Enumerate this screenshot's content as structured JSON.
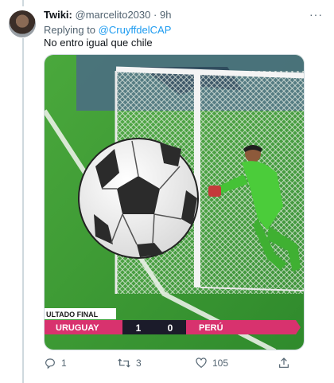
{
  "tweet": {
    "name": "Twiki",
    "separator": ":",
    "handle": "@marcelito2030",
    "dot": "·",
    "time": "9h",
    "more_label": "···",
    "reply_prefix": "Replying to",
    "reply_to": "@CruyffdelCAP",
    "text": "No entro igual que chile"
  },
  "media": {
    "scoreboard": {
      "label": "ULTADO FINAL",
      "home_team": "URUGUAY",
      "home_score": "1",
      "away_score": "0",
      "away_team": "PERÚ"
    }
  },
  "actions": {
    "replies": "1",
    "retweets": "3",
    "likes": "105"
  },
  "icons": [
    "reply-icon",
    "retweet-icon",
    "like-icon",
    "share-icon",
    "soccer-ball-icon"
  ],
  "colors": {
    "link": "#1d9bf0",
    "secondary_text": "#536471",
    "pitch_green": "#3e9a34",
    "scoreboard_pink": "#d8326e"
  }
}
